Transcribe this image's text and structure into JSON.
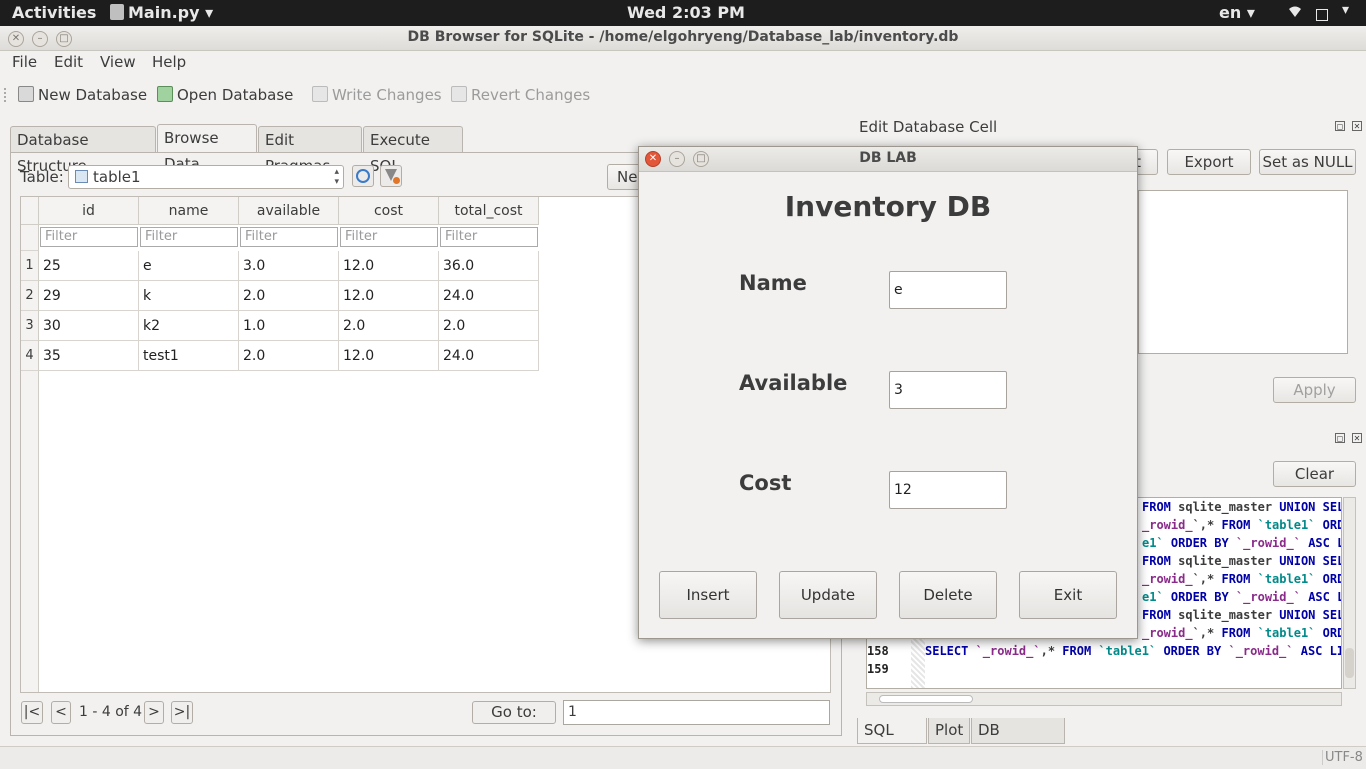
{
  "topbar": {
    "activities": "Activities",
    "app": "Main.py ▾",
    "clock": "Wed  2:03 PM",
    "lang": "en ▾"
  },
  "window": {
    "title": "DB Browser for SQLite - /home/elgohryeng/Database_lab/inventory.db"
  },
  "menu": [
    "File",
    "Edit",
    "View",
    "Help"
  ],
  "toolbar": {
    "new_db": "New Database",
    "open_db": "Open Database",
    "write": "Write Changes",
    "revert": "Revert Changes"
  },
  "tabs": [
    "Database Structure",
    "Browse Data",
    "Edit Pragmas",
    "Execute SQL"
  ],
  "browse": {
    "table_label": "Table:",
    "table_value": "table1",
    "new_record_partial": "Ne",
    "columns": [
      "id",
      "name",
      "available",
      "cost",
      "total_cost"
    ],
    "filter_placeholder": "Filter",
    "rows": [
      [
        "25",
        "e",
        "3.0",
        "12.0",
        "36.0"
      ],
      [
        "29",
        "k",
        "2.0",
        "12.0",
        "24.0"
      ],
      [
        "30",
        "k2",
        "1.0",
        "2.0",
        "2.0"
      ],
      [
        "35",
        "test1",
        "2.0",
        "12.0",
        "24.0"
      ]
    ],
    "row_numbers": [
      "1",
      "2",
      "3",
      "4"
    ],
    "nav": {
      "first": "|<",
      "prev": "<",
      "range": "1 - 4 of 4",
      "next": ">",
      "last": ">|"
    },
    "goto_label": "Go to:",
    "goto_value": "1"
  },
  "edit_cell": {
    "title": "Edit Database Cell",
    "import_partial": "t",
    "export": "Export",
    "set_null": "Set as NULL",
    "apply": "Apply"
  },
  "sql_log": {
    "clear": "Clear",
    "lines": [
      {
        "num": "",
        "parts": [
          [
            "kw",
            "FROM "
          ],
          [
            "plain",
            "sqlite_master "
          ],
          [
            "kw",
            "UNION SEL"
          ]
        ]
      },
      {
        "num": "",
        "parts": [
          [
            "id",
            "_rowid_"
          ],
          [
            "plain",
            "`,* "
          ],
          [
            "kw",
            "FROM "
          ],
          [
            "tn",
            "`table1` "
          ],
          [
            "kw",
            "ORD"
          ]
        ]
      },
      {
        "num": "",
        "parts": [
          [
            "tn",
            "e1` "
          ],
          [
            "kw",
            "ORDER BY "
          ],
          [
            "id",
            "`_rowid_` "
          ],
          [
            "kw",
            "ASC LI"
          ]
        ]
      },
      {
        "num": "",
        "parts": [
          [
            "kw",
            "FROM "
          ],
          [
            "plain",
            "sqlite_master "
          ],
          [
            "kw",
            "UNION SEL"
          ]
        ]
      },
      {
        "num": "",
        "parts": [
          [
            "id",
            "_rowid_"
          ],
          [
            "plain",
            "`,* "
          ],
          [
            "kw",
            "FROM "
          ],
          [
            "tn",
            "`table1` "
          ],
          [
            "kw",
            "ORD"
          ]
        ]
      },
      {
        "num": "",
        "parts": [
          [
            "tn",
            "e1` "
          ],
          [
            "kw",
            "ORDER BY "
          ],
          [
            "id",
            "`_rowid_` "
          ],
          [
            "kw",
            "ASC LI"
          ]
        ]
      },
      {
        "num": "",
        "parts": [
          [
            "kw",
            "FROM "
          ],
          [
            "plain",
            "sqlite_master "
          ],
          [
            "kw",
            "UNION SEL"
          ]
        ]
      },
      {
        "num": "",
        "parts": [
          [
            "id",
            "_rowid_"
          ],
          [
            "plain",
            "`,* "
          ],
          [
            "kw",
            "FROM "
          ],
          [
            "tn",
            "`table1` "
          ],
          [
            "kw",
            "ORD"
          ]
        ]
      },
      {
        "num": "158",
        "parts": [
          [
            "kw",
            "SELECT "
          ],
          [
            "id",
            "`_rowid_`"
          ],
          [
            "plain",
            ",* "
          ],
          [
            "kw",
            "FROM "
          ],
          [
            "tn",
            "`table1` "
          ],
          [
            "kw",
            "ORDER BY "
          ],
          [
            "id",
            "`_rowid_` "
          ],
          [
            "kw",
            "ASC LI"
          ]
        ]
      },
      {
        "num": "159",
        "parts": []
      }
    ]
  },
  "bottom_tabs": [
    "SQL Log",
    "Plot",
    "DB Schema"
  ],
  "status": {
    "encoding": "UTF-8"
  },
  "dialog": {
    "title": "DB LAB",
    "heading": "Inventory DB",
    "fields": [
      {
        "label": "Name",
        "value": "e"
      },
      {
        "label": "Available",
        "value": "3"
      },
      {
        "label": "Cost",
        "value": "12"
      }
    ],
    "buttons": [
      "Insert",
      "Update",
      "Delete",
      "Exit"
    ]
  },
  "colors": {
    "topbar_bg": "#1d1d1d",
    "close_button": "#e2563a",
    "sql_keyword": "#0000a8",
    "sql_table": "#008a8a",
    "sql_identifier": "#8a2a8a"
  }
}
